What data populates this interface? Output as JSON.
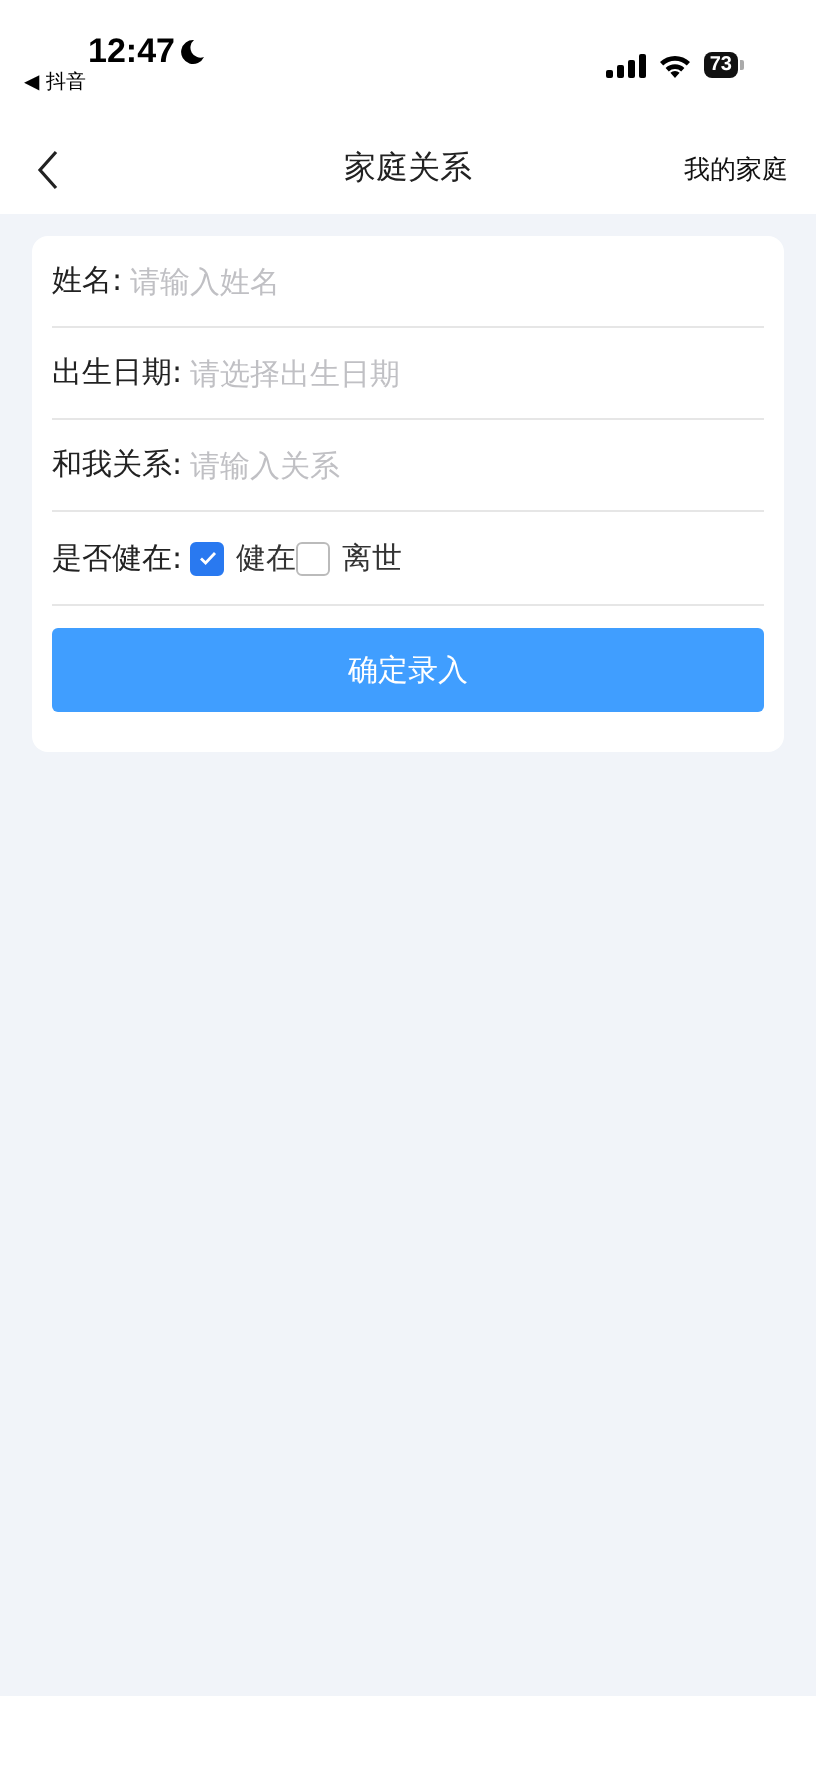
{
  "status_bar": {
    "time": "12:47",
    "back_app": "◀ 抖音",
    "battery": "73"
  },
  "nav": {
    "title": "家庭关系",
    "right_link": "我的家庭"
  },
  "form": {
    "fields": [
      {
        "label": "姓名:",
        "placeholder": "请输入姓名"
      },
      {
        "label": "出生日期:",
        "placeholder": "请选择出生日期"
      },
      {
        "label": "和我关系:",
        "placeholder": "请输入关系"
      }
    ],
    "alive": {
      "label": "是否健在:",
      "options": [
        {
          "label": "健在",
          "checked": true
        },
        {
          "label": "离世",
          "checked": false
        }
      ]
    },
    "submit": "确定录入"
  }
}
